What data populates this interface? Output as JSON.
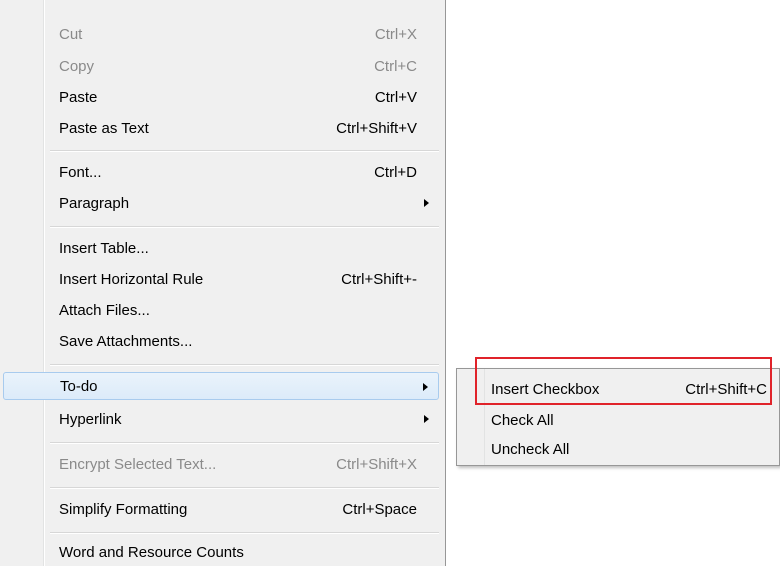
{
  "menu": {
    "items": [
      {
        "label": "Cut",
        "shortcut": "Ctrl+X"
      },
      {
        "label": "Copy",
        "shortcut": "Ctrl+C"
      },
      {
        "label": "Paste",
        "shortcut": "Ctrl+V"
      },
      {
        "label": "Paste as Text",
        "shortcut": "Ctrl+Shift+V"
      },
      {
        "label": "Font...",
        "shortcut": "Ctrl+D"
      },
      {
        "label": "Paragraph",
        "shortcut": ""
      },
      {
        "label": "Insert Table...",
        "shortcut": ""
      },
      {
        "label": "Insert Horizontal Rule",
        "shortcut": "Ctrl+Shift+-"
      },
      {
        "label": "Attach Files...",
        "shortcut": ""
      },
      {
        "label": "Save Attachments...",
        "shortcut": ""
      },
      {
        "label": "To-do",
        "shortcut": ""
      },
      {
        "label": "Hyperlink",
        "shortcut": ""
      },
      {
        "label": "Encrypt Selected Text...",
        "shortcut": "Ctrl+Shift+X"
      },
      {
        "label": "Simplify Formatting",
        "shortcut": "Ctrl+Space"
      },
      {
        "label": "Word and Resource Counts",
        "shortcut": ""
      }
    ]
  },
  "submenu": {
    "items": [
      {
        "label": "Insert Checkbox",
        "shortcut": "Ctrl+Shift+C"
      },
      {
        "label": "Check All",
        "shortcut": ""
      },
      {
        "label": "Uncheck All",
        "shortcut": ""
      }
    ]
  },
  "colors": {
    "highlight_box": "#e0232a",
    "menu_background": "#f0f0f0",
    "hover_border": "#a8cbee"
  }
}
